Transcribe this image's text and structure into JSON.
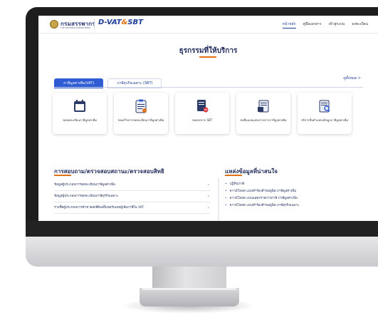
{
  "header": {
    "brand_thai": "กรมสรรพากร",
    "brand_sub": "THE REVENUE DEPARTMENT",
    "app_logo_main": "D-VAT",
    "app_logo_sep": "&",
    "app_logo_alt": "SBT",
    "nav": [
      {
        "label": "หน้าหลัก",
        "active": true
      },
      {
        "label": "คู่มือเอกสาร",
        "active": false
      },
      {
        "label": "เข้าสู่ระบบ",
        "active": false
      },
      {
        "label": "ลงทะเบียน",
        "active": false
      }
    ]
  },
  "services": {
    "title": "ธุรกรรมที่ให้บริการ",
    "see_all": "ดูทั้งหมด >",
    "tabs": [
      {
        "label": "ภาษีมูลค่าเพิ่ม(VAT)",
        "active": true
      },
      {
        "label": "ภาษีธุรกิจเฉพาะ (SBT)",
        "active": false
      }
    ],
    "cards": [
      {
        "label": "ขอจดทะเบียนภาษีมูลค่าเพิ่ม",
        "icon": "calendar-document-icon"
      },
      {
        "label": "ขอแก้ไขการจดทะเบียนภาษีมูลค่าเพิ่ม",
        "icon": "clipboard-edit-icon"
      },
      {
        "label": "ขอออกจาก SBT",
        "icon": "document-remove-icon"
      },
      {
        "label": "ขอยื่นแบบแสดงรายการภาษีมูลค่าเพิ่ม",
        "icon": "document-submit-icon"
      },
      {
        "label": "บริการขั้นตำแหน่งข้อมูลภาษีมูลค่าเพิ่ม",
        "icon": "document-search-icon"
      }
    ]
  },
  "inquiry": {
    "title": "การสอบถาม/ตรวจสอบสถานะ/ตรวจสอบสิทธิ",
    "items": [
      "ข้อมูลผู้ประกอบการจดทะเบียนภาษีมูลค่าเพิ่ม",
      "ข้อมูลผู้ประกอบการจดทะเบียนภาษีธุรกิจเฉพาะ",
      "รายชื่อผู้ประกอบการค้าขายส่งที่ต้องยื่นขอรับเลขผู้เสียภาษีใน VAT"
    ],
    "chevron": "›"
  },
  "resources": {
    "title": "แหล่งข้อมูลที่น่าสนใจ",
    "items": [
      "ปฏิทินภาษี",
      "ดาวน์โหลด แบบคำร้องคำขอยูนิต ภาษีมูลค่าเพิ่ม",
      "ดาวน์โหลด แบบแสดงรายการภาษี ภาษีมูลค่าเพิ่ม",
      "ดาวน์โหลด แบบคำร้องคำขอยูนิต ภาษีธุรกิจเฉพาะ"
    ]
  },
  "colors": {
    "primary": "#2f5bd3",
    "brand_navy": "#1f2a5a",
    "accent_orange": "#e0721a"
  }
}
